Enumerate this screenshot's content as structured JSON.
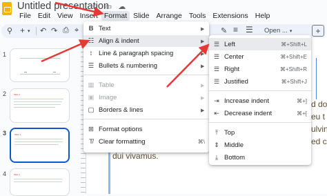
{
  "app": {
    "title": "Untitled presentation"
  },
  "title_icons": [
    "star-icon",
    "folder-icon",
    "cloud-icon"
  ],
  "menubar": [
    "File",
    "Edit",
    "View",
    "Insert",
    "Format",
    "Slide",
    "Arrange",
    "Tools",
    "Extensions",
    "Help"
  ],
  "toolbar": {
    "open_label": "Open ...",
    "plus": "+"
  },
  "slides": [
    {
      "num": "1"
    },
    {
      "num": "2",
      "label": "Slide 1"
    },
    {
      "num": "3",
      "label": "Slide 1"
    },
    {
      "num": "4",
      "label": "Slide 1"
    }
  ],
  "doc_lines": [
    "d dol",
    "eu t",
    "ulvin",
    "ed cr"
  ],
  "doc_last_line": "dui vivamus.",
  "format_menu": [
    {
      "label": "Text",
      "icon": "bold-icon",
      "submenu": true
    },
    {
      "label": "Align & indent",
      "icon": "align-indent-icon",
      "submenu": true,
      "highlighted": true
    },
    {
      "label": "Line & paragraph spacing",
      "icon": "line-spacing-icon",
      "submenu": true
    },
    {
      "label": "Bullets & numbering",
      "icon": "bullets-icon",
      "submenu": true
    },
    {
      "label": "Table",
      "icon": "table-icon",
      "submenu": true,
      "disabled": true
    },
    {
      "label": "Image",
      "icon": "image-icon",
      "submenu": true,
      "disabled": true
    },
    {
      "label": "Borders & lines",
      "icon": "borders-icon",
      "submenu": true
    },
    {
      "label": "Format options",
      "icon": "format-options-icon"
    },
    {
      "label": "Clear formatting",
      "icon": "clear-formatting-icon",
      "shortcut": "⌘\\"
    }
  ],
  "align_submenu": [
    {
      "label": "Left",
      "shortcut": "⌘+Shift+L",
      "icon": "align-left-icon",
      "highlighted": true
    },
    {
      "label": "Center",
      "shortcut": "⌘+Shift+E",
      "icon": "align-center-icon"
    },
    {
      "label": "Right",
      "shortcut": "⌘+Shift+R",
      "icon": "align-right-icon"
    },
    {
      "label": "Justified",
      "shortcut": "⌘+Shift+J",
      "icon": "align-justify-icon"
    },
    {
      "label": "Increase indent",
      "shortcut": "⌘+]",
      "icon": "increase-indent-icon"
    },
    {
      "label": "Decrease indent",
      "shortcut": "⌘+[",
      "icon": "decrease-indent-icon"
    },
    {
      "label": "Top",
      "icon": "valign-top-icon"
    },
    {
      "label": "Middle",
      "icon": "valign-middle-icon"
    },
    {
      "label": "Bottom",
      "icon": "valign-bottom-icon"
    }
  ],
  "colors": {
    "accent": "#0b57d0",
    "annotation": "#e53935",
    "menu_highlight": "#e8eaed"
  }
}
